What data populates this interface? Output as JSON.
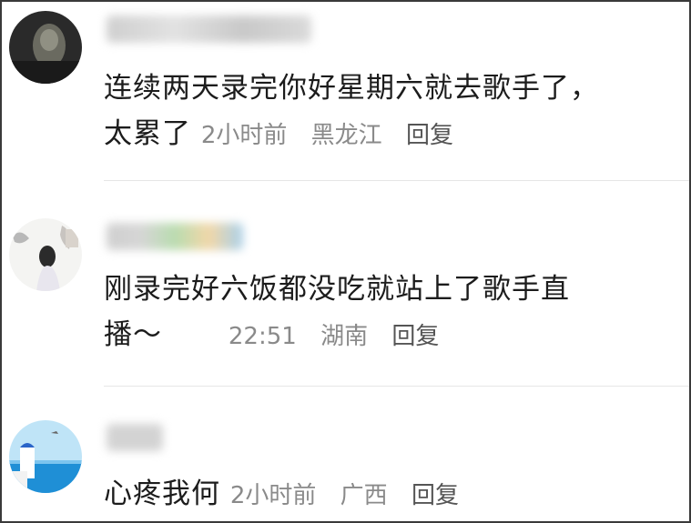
{
  "comments": [
    {
      "text_line1": "连续两天录完你好星期六就去歌手了，",
      "text_line2": "太累了",
      "time": "2小时前",
      "location": "黑龙江",
      "reply_label": "回复"
    },
    {
      "text_line1": "刚录完好六饭都没吃就站上了歌手直",
      "text_line2": "播～",
      "time": "22:51",
      "location": "湖南",
      "reply_label": "回复"
    },
    {
      "text_line1": "心疼我何",
      "time": "2小时前",
      "location": "广西",
      "reply_label": "回复"
    }
  ],
  "colors": {
    "text": "#1c1c1c",
    "meta": "#8a8a8a",
    "divider": "#e6e6e6"
  }
}
